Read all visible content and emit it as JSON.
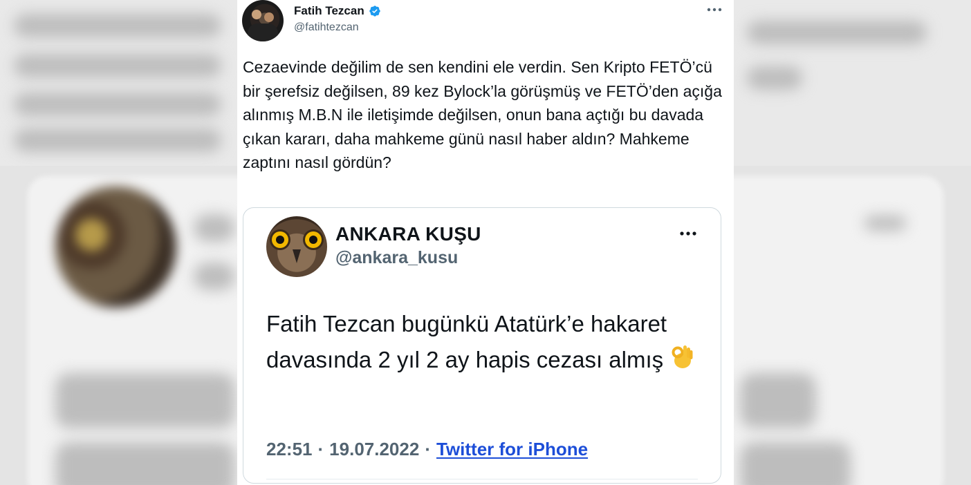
{
  "tweet": {
    "author": {
      "name": "Fatih Tezcan",
      "handle": "@fatihtezcan",
      "verified": true
    },
    "text": "Cezaevinde değilim de sen kendini ele verdin. Sen Kripto FETÖ’cü bir şerefsiz değilsen, 89 kez Bylock’la görüşmüş ve FETÖ’den açığa alınmış M.B.N ile iletişimde değilsen, onun bana açtığı bu davada çıkan kararı, daha mahkeme günü nasıl haber aldın? Mahkeme zaptını nasıl gördün?",
    "more_icon": "more-horizontal-icon"
  },
  "quoted_tweet": {
    "author": {
      "name": "ANKARA KUŞU",
      "handle": "@ankara_kusu"
    },
    "text": "Fatih Tezcan bugünkü Atatürk’e hakaret davasında 2 yıl 2 ay hapis cezası almış",
    "emoji": "ok-hand-emoji",
    "time": "22:51",
    "separator": "·",
    "date": "19.07.2022",
    "source": "Twitter for iPhone",
    "more_icon": "more-horizontal-icon"
  },
  "colors": {
    "text_primary": "#0f1419",
    "text_secondary": "#536471",
    "verified": "#1d9bf0",
    "link": "#1d4ed8",
    "border": "#cfd9de"
  }
}
